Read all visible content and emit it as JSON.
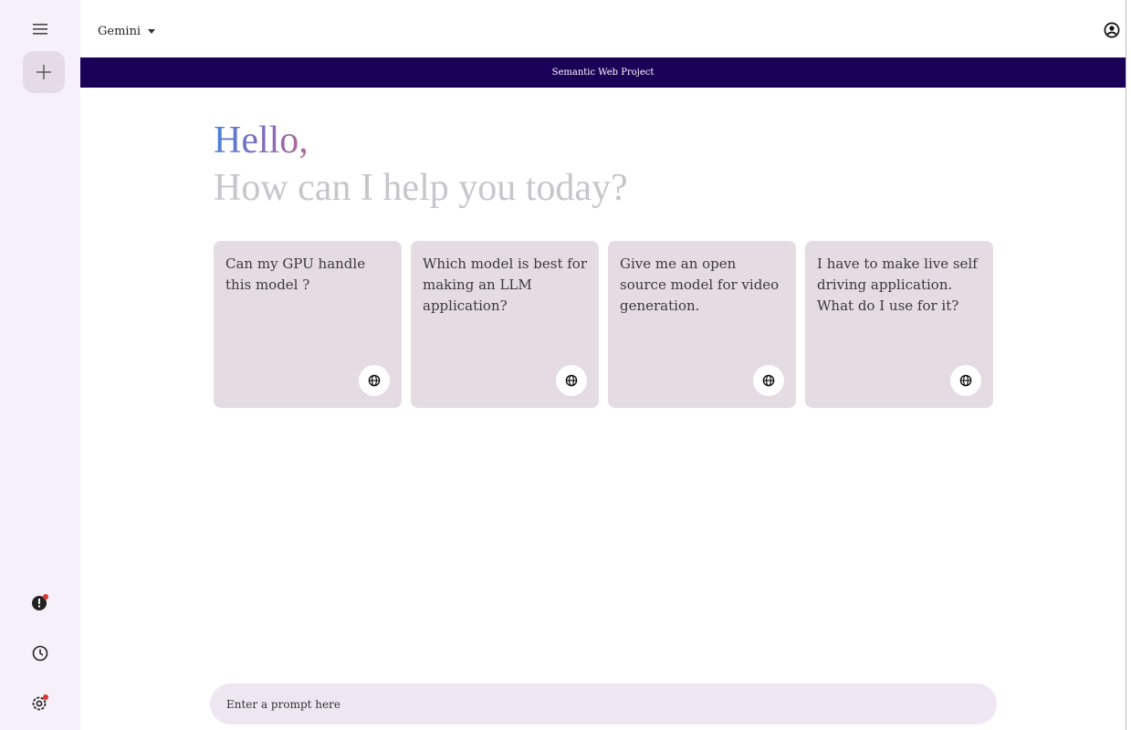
{
  "topbar": {
    "model_name": "Gemini"
  },
  "banner": {
    "title": "Semantic Web Project"
  },
  "greeting": {
    "hello": "Hello,",
    "subtitle": "How can I help you today?"
  },
  "cards": [
    {
      "text": "Can my GPU handle this model ?",
      "icon": "globe-icon"
    },
    {
      "text": "Which model is best for making an LLM application?",
      "icon": "globe-icon"
    },
    {
      "text": "Give me an open source model for video generation.",
      "icon": "globe-icon"
    },
    {
      "text": "I have to make live self driving application. What do I use for it?",
      "icon": "globe-icon"
    }
  ],
  "prompt": {
    "placeholder": "Enter a prompt here"
  },
  "sidebar": {
    "icons": [
      "menu-icon",
      "plus-icon",
      "alert-icon",
      "history-icon",
      "settings-icon"
    ],
    "notification_color": "#e0342f"
  },
  "colors": {
    "banner_bg": "#1a0157",
    "card_bg": "#e5dbe3",
    "sidebar_bg": "#f5f0f9"
  }
}
